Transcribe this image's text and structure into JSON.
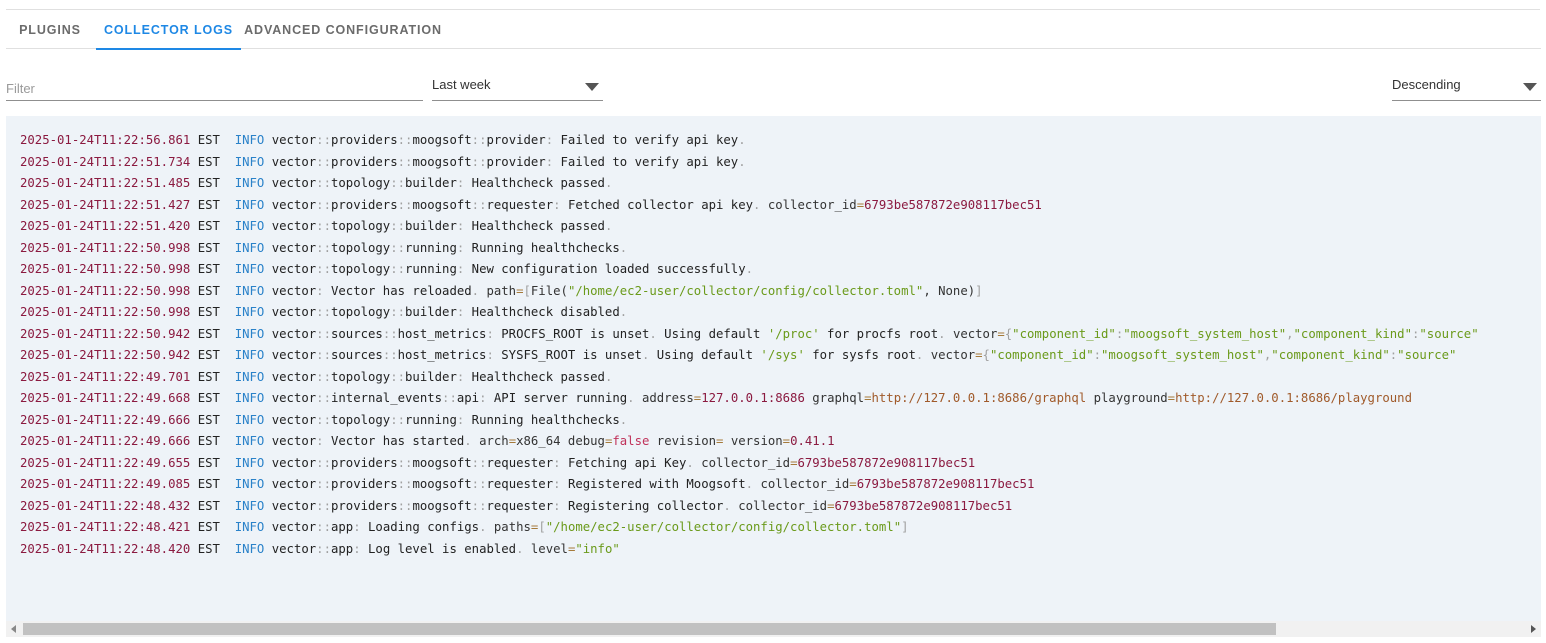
{
  "tabs": [
    {
      "label": "PLUGINS",
      "active": false
    },
    {
      "label": "COLLECTOR LOGS",
      "active": true
    },
    {
      "label": "ADVANCED CONFIGURATION",
      "active": false
    }
  ],
  "filter": {
    "placeholder": "Filter",
    "value": ""
  },
  "time_range": {
    "selected": "Last week"
  },
  "sort_order": {
    "selected": "Descending"
  },
  "logs": [
    {
      "ts": "2025-01-24T11:22:56.861",
      "tz": "EST",
      "level": "INFO",
      "module": [
        "vector",
        "providers",
        "moogsoft",
        "provider"
      ],
      "message": "Failed to verify api key",
      "fields": []
    },
    {
      "ts": "2025-01-24T11:22:51.734",
      "tz": "EST",
      "level": "INFO",
      "module": [
        "vector",
        "providers",
        "moogsoft",
        "provider"
      ],
      "message": "Failed to verify api key",
      "fields": []
    },
    {
      "ts": "2025-01-24T11:22:51.485",
      "tz": "EST",
      "level": "INFO",
      "module": [
        "vector",
        "topology",
        "builder"
      ],
      "message": "Healthcheck passed",
      "fields": []
    },
    {
      "ts": "2025-01-24T11:22:51.427",
      "tz": "EST",
      "level": "INFO",
      "module": [
        "vector",
        "providers",
        "moogsoft",
        "requester"
      ],
      "message": "Fetched collector api key",
      "fields": [
        {
          "key": "collector_id",
          "value": "6793be587872e908117bec51",
          "kind": "num"
        }
      ]
    },
    {
      "ts": "2025-01-24T11:22:51.420",
      "tz": "EST",
      "level": "INFO",
      "module": [
        "vector",
        "topology",
        "builder"
      ],
      "message": "Healthcheck passed",
      "fields": []
    },
    {
      "ts": "2025-01-24T11:22:50.998",
      "tz": "EST",
      "level": "INFO",
      "module": [
        "vector",
        "topology",
        "running"
      ],
      "message": "Running healthchecks",
      "fields": []
    },
    {
      "ts": "2025-01-24T11:22:50.998",
      "tz": "EST",
      "level": "INFO",
      "module": [
        "vector",
        "topology",
        "running"
      ],
      "message": "New configuration loaded successfully",
      "fields": []
    },
    {
      "ts": "2025-01-24T11:22:50.998",
      "tz": "EST",
      "level": "INFO",
      "module": [
        "vector"
      ],
      "message": "Vector has reloaded",
      "raw_tail": [
        [
          "key",
          "path"
        ],
        [
          "eq",
          "="
        ],
        [
          "dim",
          "["
        ],
        [
          "key",
          "File("
        ],
        [
          "str",
          "\"/home/ec2-user/collector/config/collector.toml\""
        ],
        [
          "key",
          ", None)"
        ],
        [
          "dim",
          "]"
        ]
      ]
    },
    {
      "ts": "2025-01-24T11:22:50.998",
      "tz": "EST",
      "level": "INFO",
      "module": [
        "vector",
        "topology",
        "builder"
      ],
      "message": "Healthcheck disabled",
      "fields": []
    },
    {
      "ts": "2025-01-24T11:22:50.942",
      "tz": "EST",
      "level": "INFO",
      "module": [
        "vector",
        "sources",
        "host_metrics"
      ],
      "message": "PROCFS_ROOT is unset",
      "raw_tail": [
        [
          "mod",
          "Using default "
        ],
        [
          "str",
          "'/proc'"
        ],
        [
          "mod",
          " for procfs root"
        ],
        [
          "dim",
          ". "
        ],
        [
          "key",
          "vector"
        ],
        [
          "eq",
          "="
        ],
        [
          "dim",
          "{"
        ],
        [
          "str",
          "\"component_id\""
        ],
        [
          "dim",
          ":"
        ],
        [
          "str",
          "\"moogsoft_system_host\""
        ],
        [
          "dim",
          ","
        ],
        [
          "str",
          "\"component_kind\""
        ],
        [
          "dim",
          ":"
        ],
        [
          "str",
          "\"source\""
        ]
      ]
    },
    {
      "ts": "2025-01-24T11:22:50.942",
      "tz": "EST",
      "level": "INFO",
      "module": [
        "vector",
        "sources",
        "host_metrics"
      ],
      "message": "SYSFS_ROOT is unset",
      "raw_tail": [
        [
          "mod",
          "Using default "
        ],
        [
          "str",
          "'/sys'"
        ],
        [
          "mod",
          " for sysfs root"
        ],
        [
          "dim",
          ". "
        ],
        [
          "key",
          "vector"
        ],
        [
          "eq",
          "="
        ],
        [
          "dim",
          "{"
        ],
        [
          "str",
          "\"component_id\""
        ],
        [
          "dim",
          ":"
        ],
        [
          "str",
          "\"moogsoft_system_host\""
        ],
        [
          "dim",
          ","
        ],
        [
          "str",
          "\"component_kind\""
        ],
        [
          "dim",
          ":"
        ],
        [
          "str",
          "\"source\""
        ]
      ]
    },
    {
      "ts": "2025-01-24T11:22:49.701",
      "tz": "EST",
      "level": "INFO",
      "module": [
        "vector",
        "topology",
        "builder"
      ],
      "message": "Healthcheck passed",
      "fields": []
    },
    {
      "ts": "2025-01-24T11:22:49.668",
      "tz": "EST",
      "level": "INFO",
      "module": [
        "vector",
        "internal_events",
        "api"
      ],
      "message": "API server running",
      "fields": [
        {
          "key": "address",
          "value": "127.0.0.1:8686",
          "kind": "num"
        },
        {
          "key": "graphql",
          "value": "http://127.0.0.1:8686/graphql",
          "kind": "url"
        },
        {
          "key": "playground",
          "value": "http://127.0.0.1:8686/playground",
          "kind": "url"
        }
      ]
    },
    {
      "ts": "2025-01-24T11:22:49.666",
      "tz": "EST",
      "level": "INFO",
      "module": [
        "vector",
        "topology",
        "running"
      ],
      "message": "Running healthchecks",
      "fields": []
    },
    {
      "ts": "2025-01-24T11:22:49.666",
      "tz": "EST",
      "level": "INFO",
      "module": [
        "vector"
      ],
      "message": "Vector has started",
      "fields": [
        {
          "key": "arch",
          "value": "x86_64",
          "kind": "plain"
        },
        {
          "key": "debug",
          "value": "false",
          "kind": "bool"
        },
        {
          "key": "revision",
          "value": "",
          "kind": "plain"
        },
        {
          "key": "version",
          "value": "0.41.1",
          "kind": "num"
        }
      ]
    },
    {
      "ts": "2025-01-24T11:22:49.655",
      "tz": "EST",
      "level": "INFO",
      "module": [
        "vector",
        "providers",
        "moogsoft",
        "requester"
      ],
      "message": "Fetching api Key",
      "fields": [
        {
          "key": "collector_id",
          "value": "6793be587872e908117bec51",
          "kind": "num"
        }
      ]
    },
    {
      "ts": "2025-01-24T11:22:49.085",
      "tz": "EST",
      "level": "INFO",
      "module": [
        "vector",
        "providers",
        "moogsoft",
        "requester"
      ],
      "message": "Registered with Moogsoft",
      "fields": [
        {
          "key": "collector_id",
          "value": "6793be587872e908117bec51",
          "kind": "num"
        }
      ]
    },
    {
      "ts": "2025-01-24T11:22:48.432",
      "tz": "EST",
      "level": "INFO",
      "module": [
        "vector",
        "providers",
        "moogsoft",
        "requester"
      ],
      "message": "Registering collector",
      "fields": [
        {
          "key": "collector_id",
          "value": "6793be587872e908117bec51",
          "kind": "num"
        }
      ]
    },
    {
      "ts": "2025-01-24T11:22:48.421",
      "tz": "EST",
      "level": "INFO",
      "module": [
        "vector",
        "app"
      ],
      "message": "Loading configs",
      "raw_tail": [
        [
          "key",
          "paths"
        ],
        [
          "eq",
          "="
        ],
        [
          "dim",
          "["
        ],
        [
          "str",
          "\"/home/ec2-user/collector/config/collector.toml\""
        ],
        [
          "dim",
          "]"
        ]
      ]
    },
    {
      "ts": "2025-01-24T11:22:48.420",
      "tz": "EST",
      "level": "INFO",
      "module": [
        "vector",
        "app"
      ],
      "message": "Log level is enabled",
      "fields": [
        {
          "key": "level",
          "value": "\"info\"",
          "kind": "str"
        }
      ]
    }
  ],
  "colors": {
    "accent": "#1e88e5",
    "timestamp": "#8b1a40",
    "level": "#2a82c9",
    "string": "#6a9a1a",
    "panel_bg": "#eef3f8"
  },
  "scrollbar": {
    "horizontal_position": 0.0,
    "visible_fraction": 0.83
  }
}
